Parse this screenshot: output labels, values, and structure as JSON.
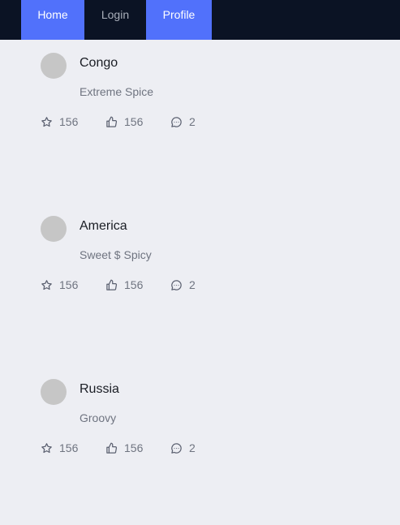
{
  "nav": {
    "home": "Home",
    "login": "Login",
    "profile": "Profile"
  },
  "cards": [
    {
      "title": "Congo",
      "subtitle": "Extreme Spice",
      "stars": "156",
      "likes": "156",
      "comments": "2"
    },
    {
      "title": "America",
      "subtitle": "Sweet $ Spicy",
      "stars": "156",
      "likes": "156",
      "comments": "2"
    },
    {
      "title": "Russia",
      "subtitle": "Groovy",
      "stars": "156",
      "likes": "156",
      "comments": "2"
    }
  ],
  "colors": {
    "background": "#edeef3",
    "navbar": "#0b1324",
    "nav_active": "#5171fb",
    "avatar": "#c6c6c6"
  }
}
